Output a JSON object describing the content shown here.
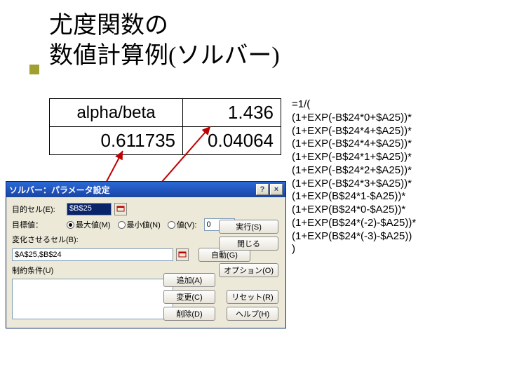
{
  "title_line1": "尤度関数の",
  "title_line2": "数値計算例(ソルバー)",
  "table": {
    "header": "alpha/beta",
    "val_top": "1.436",
    "val_bl": "0.611735",
    "val_br": "0.04064"
  },
  "formula": "=1/(\n(1+EXP(-B$24*0+$A25))*\n(1+EXP(-B$24*4+$A25))*\n(1+EXP(-B$24*4+$A25))*\n(1+EXP(-B$24*1+$A25))*\n(1+EXP(-B$24*2+$A25))*\n(1+EXP(-B$24*3+$A25))*\n(1+EXP(B$24*1-$A25))*\n(1+EXP(B$24*0-$A25))*\n(1+EXP(B$24*(-2)-$A25))*\n(1+EXP(B$24*(-3)-$A25))\n)",
  "dialog": {
    "title": "ソルバー：パラメータ設定",
    "help_icon": "?",
    "close_icon": "×",
    "target_cell_label": "目的セル(E):",
    "target_cell_value": "$B$25",
    "goal_label": "目標値：",
    "radio_max": "最大値(M)",
    "radio_min": "最小値(N)",
    "radio_val": "値(V):",
    "radio_val_input": "0",
    "change_cells_label": "変化させるセル(B):",
    "change_cells_value": "$A$25,$B$24",
    "auto_btn": "自動(G)",
    "constraint_label": "制約条件(U)",
    "btn_solve": "実行(S)",
    "btn_close": "閉じる",
    "btn_options": "オプション(O)",
    "btn_add": "追加(A)",
    "btn_change": "変更(C)",
    "btn_delete": "削除(D)",
    "btn_reset": "リセット(R)",
    "btn_help": "ヘルプ(H)"
  }
}
